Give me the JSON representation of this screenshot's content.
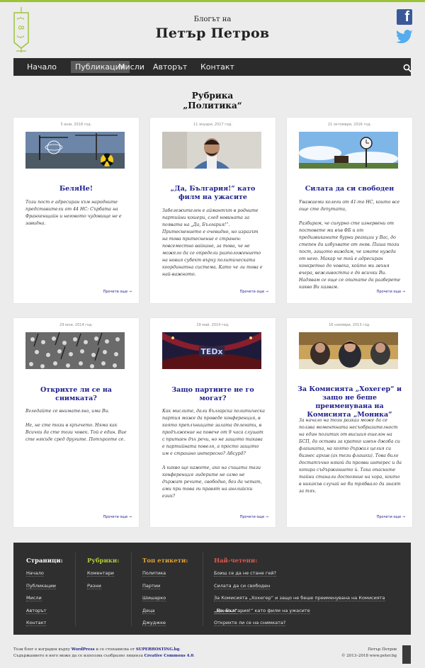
{
  "header": {
    "subtitle": "Блогът на",
    "title": "Петър Петров",
    "facebook_letter": "f"
  },
  "nav": {
    "items": [
      "Начало",
      "Публикации",
      "Мисли",
      "Авторът",
      "Контакт"
    ],
    "active": "Публикации"
  },
  "category": {
    "prefix": "Рубрика",
    "name": "„Политика“"
  },
  "posts": [
    {
      "date": "5 юни, 2018 год.",
      "title": "БеляНе!",
      "excerpt": "Този пост е адресиран към народните представители от 44 НС: Сърбата на Франкенщайн и неговото чудовище не е завидна.",
      "more": "Прочети още →",
      "thumb": "construction-radiation"
    },
    {
      "date": "11 януари, 2017 год.",
      "title": "„Да, България!“ като филм на ужасите",
      "excerpt": "Забележителен е аймантът в родните партийни кошери, след новината за появата на „Да, България!“. Притеснението е очевидно, но изразът на това притеснение е странен: повсеместно вайкане, за това, че не можело да се определи разположението на новия субект върху политическата координатна система. Като че ли това е най-важното.",
      "more": "Прочети още →",
      "thumb": "man-portrait"
    },
    {
      "date": "21 октомври, 2016 год.",
      "title": "Силата да си свободен",
      "excerpt": "Уважаеми колеги от 41-то НС, които все още сте депутати,\n\nРазбирам, че сигурно сте изнервени от постовете ми във ФБ и от предизвиканите бурни реакции у Вас, до степен да избухвате от гняв. Пиша този пост, защото виждам, че имате нужда от него. Макар че той е адресиран конкретно до човека, който ми звъня вчера, вежливостта е до всички Ви. Надявам се още се опитате да разберете какво Ви казвам.",
      "more": "Прочети още →",
      "thumb": "clock-sky"
    },
    {
      "date": "29 юни, 2014 год.",
      "title": "Открихте ли се на снимката?",
      "excerpt": "Вгледайте се внимателно, има Ви.\n\nНе, не сте този в кръгчето. Няма как Всички да сте този човек. Той е един. Вие сте някъде сред другите. Потърсете се.",
      "more": "Прочети още →",
      "thumb": "crowd-bw"
    },
    {
      "date": "19 май, 2014 год.",
      "title": "Защо партиите не го могат?",
      "excerpt": "Как мислите, дали българска политическа партия може да проведе конференция, в която преплъниците залата делегати, в продължение на повече от 9 часа слушат с притаен дъх речи, но не защото такава е партийната повеля, а просто защото им е страшно интересно? Абсурд?\n\nА какво ще кажете, ако на същата тази конференция лидерите не само не държат речите, свободно, без да четат, ами при това ги правят на английски език?",
      "more": "Прочети още →",
      "thumb": "ted-stage"
    },
    {
      "date": "16 ноември, 2013 год.",
      "title": "За Комисията „Хохегер“ и защо не беше преименувана на Комисията „Моника“",
      "excerpt": "За начало на този разказ може да се ползва моментната несъобразителност на един политик от висшия ешелон на БСП, да остави за кратко извън джоба си флашката, на която държал целия си бизнес архив (ах тези флашки). Това било достатъчно някой да прояви интерес и да копира съдържанието ѝ. Така опасните тайни станали достояние на хора, които в никакъв случай не би трябвало да знаят за тях.",
      "more": "Прочети още →",
      "thumb": "commission-meeting"
    }
  ],
  "footer": {
    "columns": [
      {
        "title": "Страници:",
        "color": "#ffffff",
        "items": [
          "Начало",
          "Публикации",
          "Мисли",
          "Авторът",
          "Контакт"
        ]
      },
      {
        "title": "Рубрики:",
        "color": "#b7cc3a",
        "items": [
          "Коментари",
          "Разни"
        ]
      },
      {
        "title": "Топ етикети:",
        "color": "#e3a336",
        "items": [
          "Политика",
          "Партии",
          "Шишарко",
          "Деца",
          "Джуджке"
        ]
      },
      {
        "title": "Най-четени:",
        "color": "#e2574c",
        "items": [
          "Боиш се да не стане гей?",
          "Силата да си свободен",
          "За Комисията „Хохегер“ и защо не беше преименувана на Комисията „Моника“",
          "„Да, България!“ като филм на ужасите",
          "Открихте ли се на снимката?"
        ]
      }
    ]
  },
  "bottom": {
    "line1_pre": "Този блог е изграден върху ",
    "wordpress": "WordPress",
    "line1_mid": " и се стопанисва от ",
    "hosting": "SUPERHOSTING.bg",
    "line1_end": ".",
    "line2_pre": "Съдържанието в него може да се използва съобразно лиценза ",
    "license": "Creative Commons 4.0",
    "line2_end": ".",
    "author": "Петър Петров",
    "copyright": "© 2013–2018 www.peter.bg"
  },
  "colors": {
    "accent_green": "#9cc43a",
    "nav_bg": "#2b2b2b",
    "link": "#1d1d8c",
    "facebook": "#3b5998",
    "twitter": "#55acee"
  }
}
